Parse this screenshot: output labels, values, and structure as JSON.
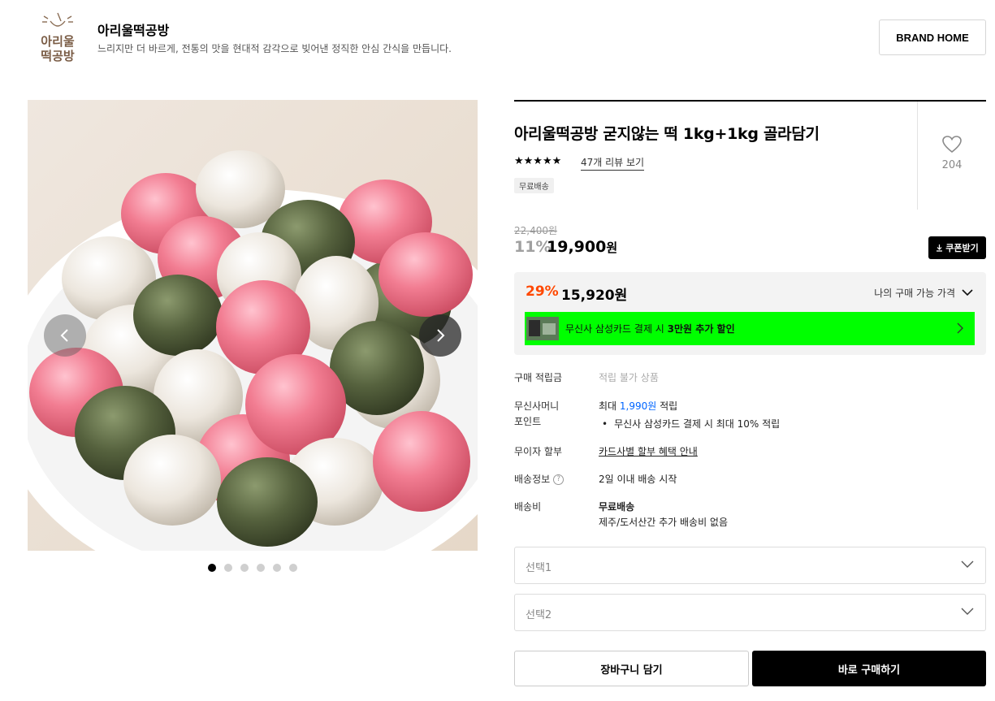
{
  "brand": {
    "logo_text": [
      "아리울",
      "떡공방"
    ],
    "name": "아리울떡공방",
    "description": "느리지만 더 바르게, 전통의 맛을 현대적 감각으로 빚어낸 정직한 안심 간식을 만듭니다.",
    "home_button": "BRAND HOME"
  },
  "gallery": {
    "image_count": 6,
    "active_index": 0
  },
  "product": {
    "title": "아리울떡공방 굳지않는 떡 1kg+1kg 골라담기",
    "rating_stars": "★★★★★",
    "rating_value": 5,
    "review_link": "47개 리뷰 보기",
    "badge": "무료배송",
    "like_count": "204"
  },
  "price": {
    "original": "22,400원",
    "discount_pct": "11%",
    "sale_price": "19,900",
    "currency": "원",
    "coupon_button": "쿠폰받기"
  },
  "best_price": {
    "pct": "29%",
    "amount": "15,920원",
    "toggle_label": "나의 구매 가능 가격",
    "banner_prefix": "무신사 삼성카드 결제 시 ",
    "banner_bold": "3만원 추가 할인",
    "accent": "#ff4800",
    "banner_color": "#00ff00"
  },
  "info": {
    "points_label": "구매 적립금",
    "points_value": "적립 불가 상품",
    "money_label_1": "무신사머니",
    "money_label_2": "포인트",
    "money_prefix": "최대 ",
    "money_amount": "1,990원",
    "money_suffix": " 적립",
    "money_bullet": "무신사 삼성카드 결제 시 최대 10% 적립",
    "installment_label": "무이자 할부",
    "installment_value": "카드사별 할부 혜택 안내",
    "shipping_label": "배송정보",
    "shipping_value": "2일 이내 배송 시작",
    "fee_label": "배송비",
    "fee_value": "무료배송",
    "fee_note": "제주/도서산간 추가 배송비 없음"
  },
  "options": [
    {
      "placeholder": "선택1"
    },
    {
      "placeholder": "선택2"
    }
  ],
  "actions": {
    "cart": "장바구니 담기",
    "buy": "바로 구매하기"
  }
}
